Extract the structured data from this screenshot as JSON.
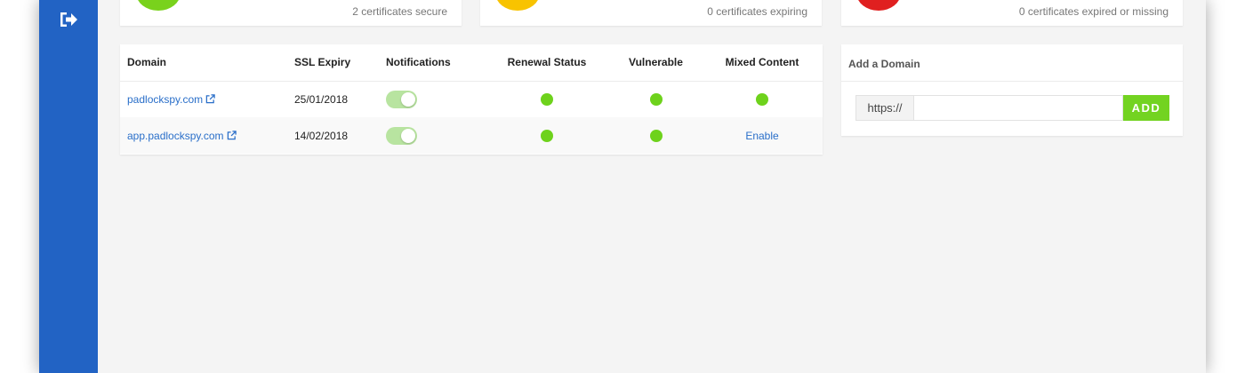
{
  "stats": [
    {
      "text": "2 certificates secure",
      "color": "#79d21c"
    },
    {
      "text": "0 certificates expiring",
      "color": "#f8c300"
    },
    {
      "text": "0 certificates expired or missing",
      "color": "#e02020"
    }
  ],
  "sidebar": {
    "logout_icon": "sign-out-icon"
  },
  "table": {
    "headers": [
      "Domain",
      "SSL Expiry",
      "Notifications",
      "Renewal Status",
      "Vulnerable",
      "Mixed Content"
    ],
    "rows": [
      {
        "domain": "padlockspy.com",
        "expiry": "25/01/2018",
        "notifications": true,
        "renewal": "ok",
        "vulnerable": "ok",
        "mixed": "ok"
      },
      {
        "domain": "app.padlockspy.com",
        "expiry": "14/02/2018",
        "notifications": true,
        "renewal": "ok",
        "vulnerable": "ok",
        "mixed": "Enable"
      }
    ]
  },
  "add_domain": {
    "title": "Add a Domain",
    "prefix": "https://",
    "input_value": "",
    "placeholder": "",
    "button_label": "ADD"
  },
  "colors": {
    "sidebar": "#2263c4",
    "accent_green": "#73d321",
    "link": "#2a6fc9"
  }
}
